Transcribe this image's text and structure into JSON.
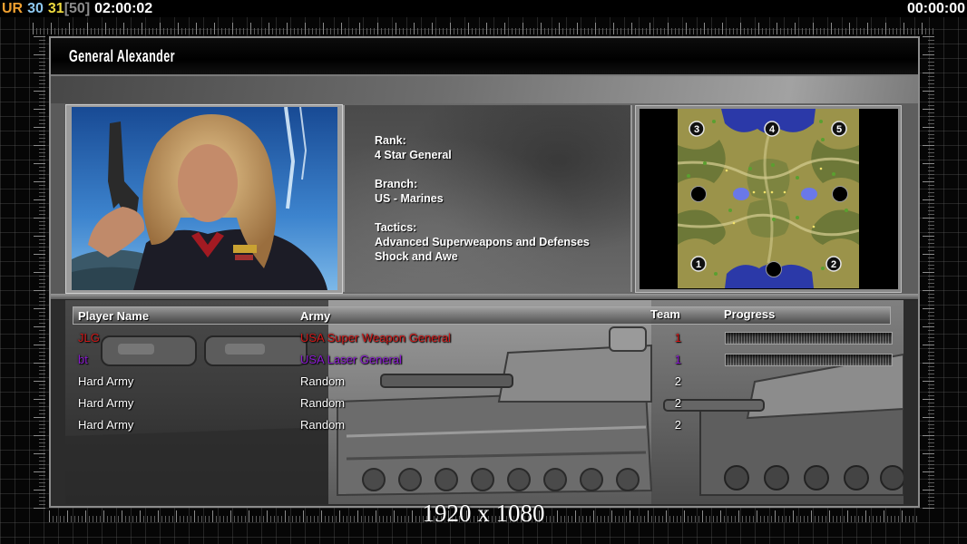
{
  "hud": {
    "items": [
      {
        "text": "UR",
        "color": "#f0a030"
      },
      {
        "text": "30",
        "color": "#8ec8f0"
      },
      {
        "text": "31",
        "color": "#f0dc40"
      },
      {
        "text": "[50]",
        "color": "#8c8c8c"
      },
      {
        "text": "02:00:02",
        "color": "#ffffff"
      }
    ],
    "right_timer": "00:00:00"
  },
  "general": {
    "name": "General Alexander",
    "details": [
      {
        "label": "Rank:",
        "values": [
          "4 Star General"
        ]
      },
      {
        "label": "Branch:",
        "values": [
          "US - Marines"
        ]
      },
      {
        "label": "Tactics:",
        "values": [
          "Advanced Superweapons and Defenses",
          "Shock and Awe"
        ]
      }
    ]
  },
  "minimap": {
    "start_position_labels": [
      "3",
      "4",
      "5",
      "1",
      "2"
    ]
  },
  "players": {
    "headers": {
      "name": "Player Name",
      "army": "Army",
      "team": "Team",
      "progress": "Progress"
    },
    "rows": [
      {
        "name": "JLG",
        "army": "USA Super Weapon General",
        "team": "1",
        "color": "#d01818",
        "progress": 0
      },
      {
        "name": "bt",
        "army": "USA Laser General",
        "team": "1",
        "color": "#8a1ad0",
        "progress": 0
      },
      {
        "name": "Hard Army",
        "army": "Random",
        "team": "2",
        "color": "#ffffff"
      },
      {
        "name": "Hard Army",
        "army": "Random",
        "team": "2",
        "color": "#ffffff"
      },
      {
        "name": "Hard Army",
        "army": "Random",
        "team": "2",
        "color": "#ffffff"
      }
    ]
  },
  "caption": "1920 x 1080"
}
